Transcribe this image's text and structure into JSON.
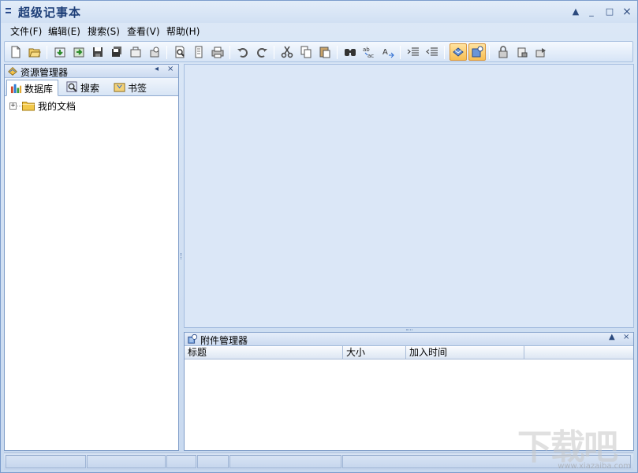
{
  "window": {
    "title": "超级记事本",
    "controls": {
      "pin": "▲",
      "minimize": "_",
      "maximize": "□",
      "close": "×"
    }
  },
  "menu": [
    "文件(F)",
    "编辑(E)",
    "搜索(S)",
    "查看(V)",
    "帮助(H)"
  ],
  "toolbar": {
    "buttons": [
      "new-file-icon",
      "open-folder-icon",
      "import-icon",
      "export-icon",
      "save-icon",
      "save-all-icon",
      "open-icon",
      "recycle-icon",
      "print-preview-icon",
      "page-setup-icon",
      "print-icon",
      "undo-icon",
      "redo-icon",
      "cut-icon",
      "copy-icon",
      "paste-icon",
      "find-icon",
      "replace-icon",
      "find-next-icon",
      "indent-icon",
      "outdent-icon",
      "database-view-icon",
      "attachment-view-icon",
      "lock-icon",
      "encrypt-icon",
      "settings-icon"
    ]
  },
  "explorer": {
    "title": "资源管理器",
    "pin": "◂",
    "close": "×",
    "tabs": [
      {
        "label": "数据库",
        "icon": "database-icon",
        "active": true
      },
      {
        "label": "搜索",
        "icon": "search-icon",
        "active": false
      },
      {
        "label": "书签",
        "icon": "bookmark-icon",
        "active": false
      }
    ],
    "tree": [
      {
        "label": "我的文档",
        "expander": "+"
      }
    ]
  },
  "attachments": {
    "title": "附件管理器",
    "pin": "▲",
    "close": "×",
    "columns": [
      "标题",
      "大小",
      "加入时间",
      ""
    ]
  },
  "statusbar": {
    "cells": [
      "",
      "",
      "",
      "",
      "",
      ""
    ]
  },
  "watermark": {
    "text": "下载吧",
    "url": "www.xiazaiba.com"
  },
  "colors": {
    "accent": "#1e3f78",
    "editor_bg": "#dbe7f7",
    "active_button": "#f7be52"
  }
}
